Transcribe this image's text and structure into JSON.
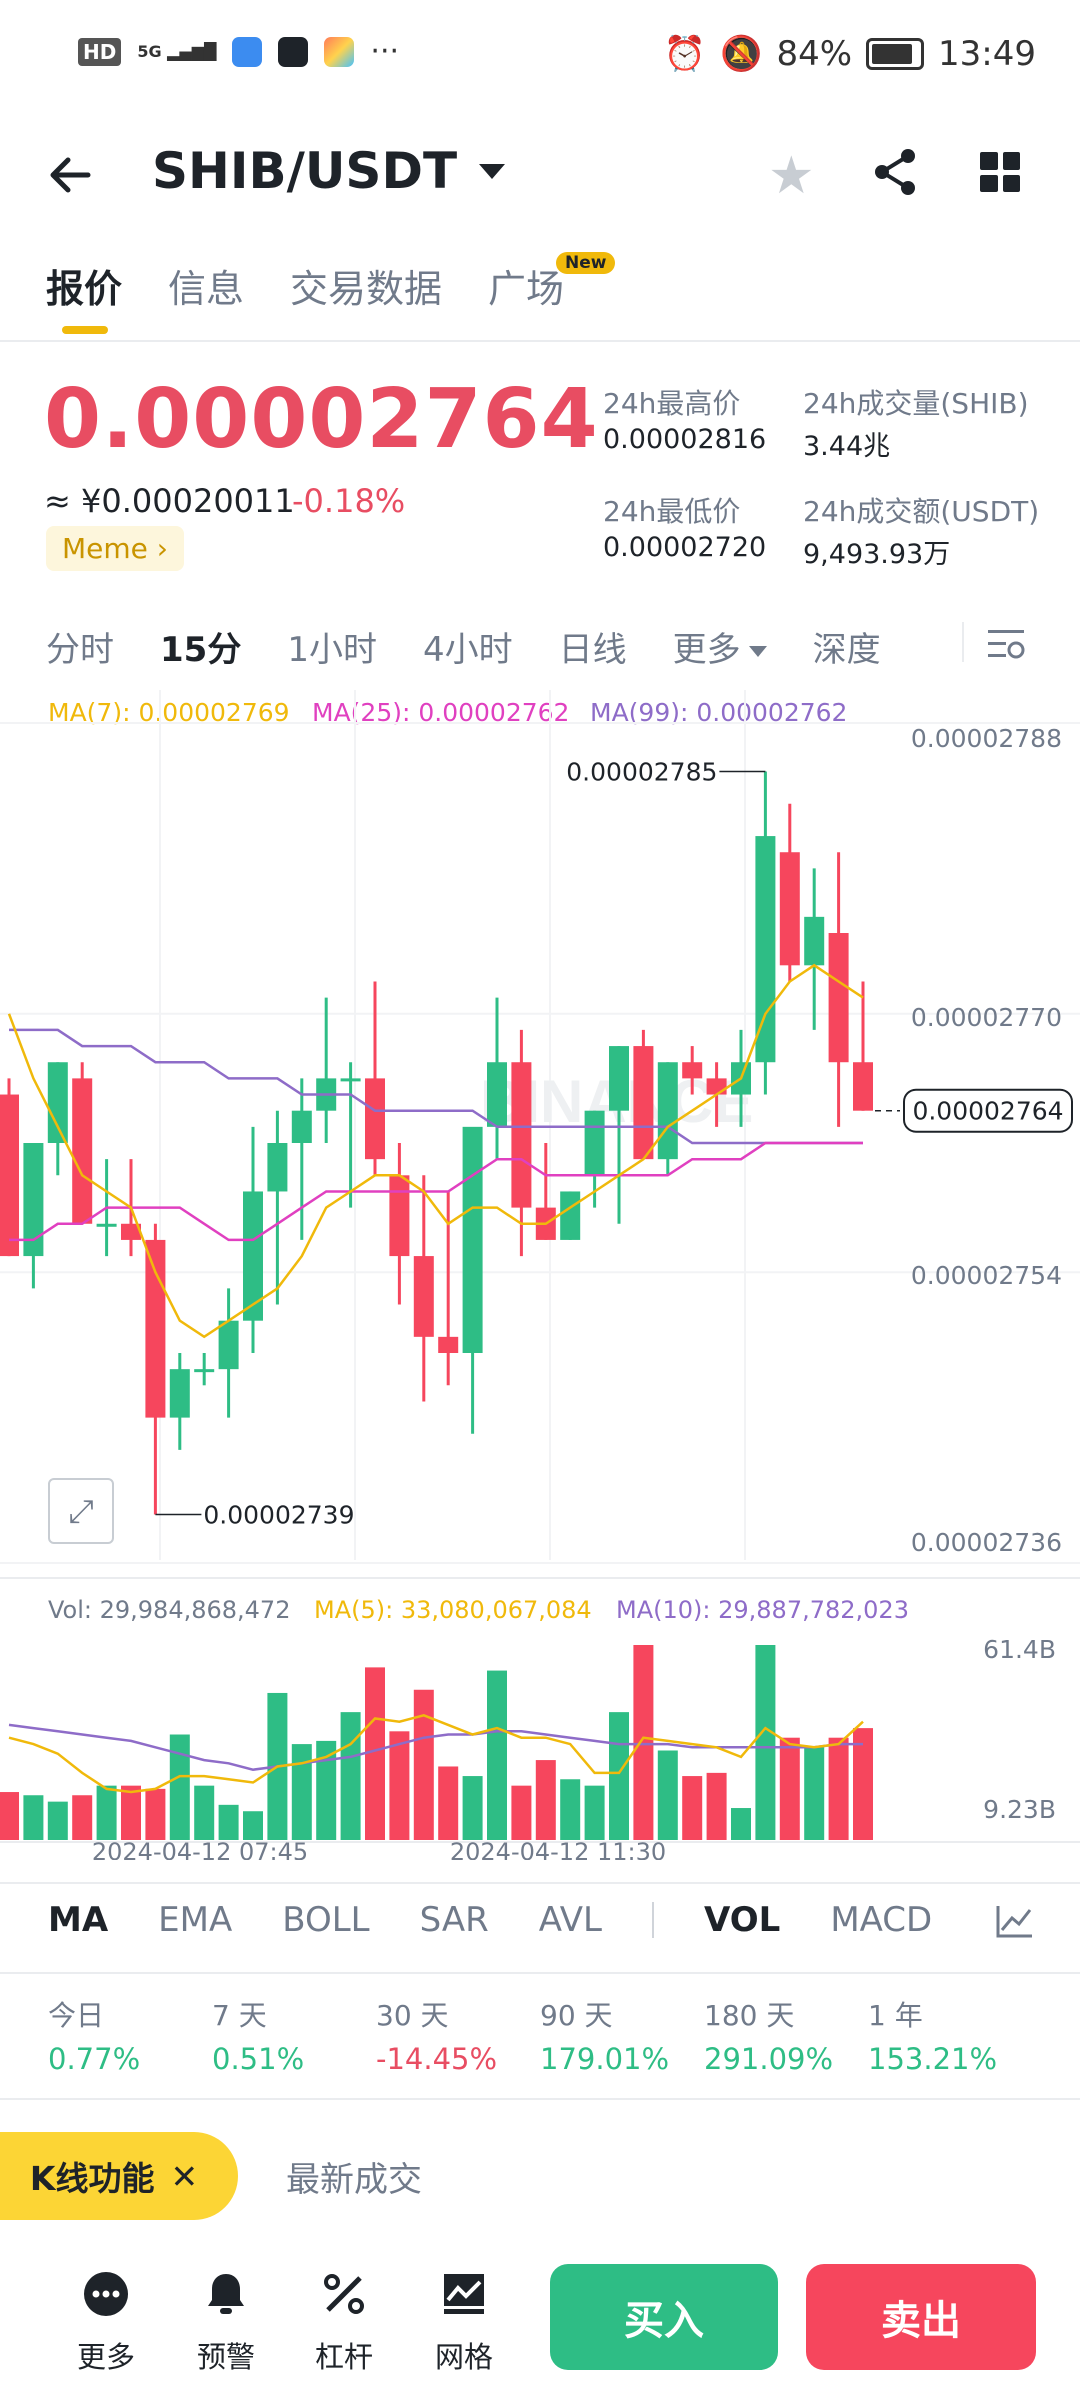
{
  "status_bar": {
    "network": "5G",
    "battery": "84%",
    "time": "13:49",
    "hd": "HD",
    "more": "···"
  },
  "header": {
    "pair": "SHIB/USDT"
  },
  "tabs": [
    {
      "label": "报价"
    },
    {
      "label": "信息"
    },
    {
      "label": "交易数据"
    },
    {
      "label": "广场"
    }
  ],
  "tab_new_badge": "New",
  "price": {
    "last": "0.00002764",
    "cny": "≈ ¥0.00020011",
    "change": "-0.18%",
    "tag": "Meme"
  },
  "stats": {
    "high_label": "24h最高价",
    "high": "0.00002816",
    "vol_label": "24h成交量(SHIB)",
    "vol": "3.44兆",
    "low_label": "24h最低价",
    "low": "0.00002720",
    "amount_label": "24h成交额(USDT)",
    "amount": "9,493.93万"
  },
  "intervals": [
    "分时",
    "15分",
    "1小时",
    "4小时",
    "日线",
    "更多",
    "深度"
  ],
  "ma_legend": {
    "ma7": "MA(7): 0.00002769",
    "ma25": "MA(25): 0.00002762",
    "ma99": "MA(99): 0.00002762"
  },
  "vol_legend": {
    "vol": "Vol: 29,984,868,472",
    "ma5": "MA(5): 33,080,067,084",
    "ma10": "MA(10): 29,887,782,023"
  },
  "indicators": [
    "MA",
    "EMA",
    "BOLL",
    "SAR",
    "AVL",
    "VOL",
    "MACD"
  ],
  "performance": [
    {
      "label": "今日",
      "value": "0.77%",
      "dir": "up"
    },
    {
      "label": "7 天",
      "value": "0.51%",
      "dir": "up"
    },
    {
      "label": "30 天",
      "value": "-14.45%",
      "dir": "down"
    },
    {
      "label": "90 天",
      "value": "179.01%",
      "dir": "up"
    },
    {
      "label": "180 天",
      "value": "291.09%",
      "dir": "up"
    },
    {
      "label": "1 年",
      "value": "153.21%",
      "dir": "up"
    }
  ],
  "bottom": {
    "kline_label": "K线功能",
    "latest_trades": "最新成交",
    "more": "更多",
    "alert": "预警",
    "leverage": "杠杆",
    "grid": "网格",
    "buy": "买入",
    "sell": "卖出"
  },
  "colors": {
    "up": "#2ebd85",
    "down": "#f6465d",
    "ma7": "#f0b90b",
    "ma25": "#e040c0",
    "ma99": "#8e6cc8"
  },
  "chart_data": {
    "type": "candlestick",
    "price_axis": {
      "ticks": [
        "0.00002788",
        "0.00002770",
        "0.00002754",
        "0.00002736"
      ],
      "ylim": [
        2.736e-05,
        2.788e-05
      ]
    },
    "last_price_label": "0.00002764",
    "high_marker": "0.00002785",
    "low_marker": "0.00002739",
    "time_labels": [
      "2024-04-12 07:45",
      "2024-04-12 11:30"
    ],
    "volume_axis": {
      "ticks": [
        "61.4B",
        "9.23B"
      ]
    },
    "candles": [
      {
        "o": 2.765e-05,
        "h": 2.766e-05,
        "l": 2.755e-05,
        "c": 2.755e-05
      },
      {
        "o": 2.755e-05,
        "h": 2.762e-05,
        "l": 2.753e-05,
        "c": 2.762e-05
      },
      {
        "o": 2.762e-05,
        "h": 2.767e-05,
        "l": 2.76e-05,
        "c": 2.767e-05
      },
      {
        "o": 2.766e-05,
        "h": 2.767e-05,
        "l": 2.757e-05,
        "c": 2.757e-05
      },
      {
        "o": 2.757e-05,
        "h": 2.761e-05,
        "l": 2.755e-05,
        "c": 2.757e-05
      },
      {
        "o": 2.757e-05,
        "h": 2.761e-05,
        "l": 2.755e-05,
        "c": 2.756e-05
      },
      {
        "o": 2.756e-05,
        "h": 2.757e-05,
        "l": 2.739e-05,
        "c": 2.745e-05
      },
      {
        "o": 2.745e-05,
        "h": 2.749e-05,
        "l": 2.743e-05,
        "c": 2.748e-05
      },
      {
        "o": 2.748e-05,
        "h": 2.749e-05,
        "l": 2.747e-05,
        "c": 2.748e-05
      },
      {
        "o": 2.748e-05,
        "h": 2.753e-05,
        "l": 2.745e-05,
        "c": 2.751e-05
      },
      {
        "o": 2.751e-05,
        "h": 2.763e-05,
        "l": 2.749e-05,
        "c": 2.759e-05
      },
      {
        "o": 2.759e-05,
        "h": 2.764e-05,
        "l": 2.752e-05,
        "c": 2.762e-05
      },
      {
        "o": 2.762e-05,
        "h": 2.766e-05,
        "l": 2.756e-05,
        "c": 2.764e-05
      },
      {
        "o": 2.764e-05,
        "h": 2.771e-05,
        "l": 2.762e-05,
        "c": 2.766e-05
      },
      {
        "o": 2.766e-05,
        "h": 2.767e-05,
        "l": 2.758e-05,
        "c": 2.766e-05
      },
      {
        "o": 2.766e-05,
        "h": 2.772e-05,
        "l": 2.76e-05,
        "c": 2.761e-05
      },
      {
        "o": 2.76e-05,
        "h": 2.762e-05,
        "l": 2.752e-05,
        "c": 2.755e-05
      },
      {
        "o": 2.755e-05,
        "h": 2.76e-05,
        "l": 2.746e-05,
        "c": 2.75e-05
      },
      {
        "o": 2.75e-05,
        "h": 2.759e-05,
        "l": 2.747e-05,
        "c": 2.749e-05
      },
      {
        "o": 2.749e-05,
        "h": 2.762e-05,
        "l": 2.744e-05,
        "c": 2.763e-05
      },
      {
        "o": 2.763e-05,
        "h": 2.771e-05,
        "l": 2.761e-05,
        "c": 2.767e-05
      },
      {
        "o": 2.767e-05,
        "h": 2.769e-05,
        "l": 2.755e-05,
        "c": 2.758e-05
      },
      {
        "o": 2.758e-05,
        "h": 2.762e-05,
        "l": 2.756e-05,
        "c": 2.756e-05
      },
      {
        "o": 2.756e-05,
        "h": 2.759e-05,
        "l": 2.756e-05,
        "c": 2.759e-05
      },
      {
        "o": 2.76e-05,
        "h": 2.764e-05,
        "l": 2.758e-05,
        "c": 2.764e-05
      },
      {
        "o": 2.764e-05,
        "h": 2.768e-05,
        "l": 2.757e-05,
        "c": 2.768e-05
      },
      {
        "o": 2.768e-05,
        "h": 2.769e-05,
        "l": 2.761e-05,
        "c": 2.761e-05
      },
      {
        "o": 2.761e-05,
        "h": 2.767e-05,
        "l": 2.76e-05,
        "c": 2.767e-05
      },
      {
        "o": 2.767e-05,
        "h": 2.768e-05,
        "l": 2.765e-05,
        "c": 2.766e-05
      },
      {
        "o": 2.766e-05,
        "h": 2.767e-05,
        "l": 2.763e-05,
        "c": 2.765e-05
      },
      {
        "o": 2.765e-05,
        "h": 2.769e-05,
        "l": 2.763e-05,
        "c": 2.767e-05
      },
      {
        "o": 2.767e-05,
        "h": 2.785e-05,
        "l": 2.765e-05,
        "c": 2.781e-05
      },
      {
        "o": 2.78e-05,
        "h": 2.783e-05,
        "l": 2.772e-05,
        "c": 2.773e-05
      },
      {
        "o": 2.773e-05,
        "h": 2.779e-05,
        "l": 2.769e-05,
        "c": 2.776e-05
      },
      {
        "o": 2.775e-05,
        "h": 2.78e-05,
        "l": 2.763e-05,
        "c": 2.767e-05
      },
      {
        "o": 2.767e-05,
        "h": 2.772e-05,
        "l": 2.764e-05,
        "c": 2.764e-05
      }
    ],
    "ma7": [
      2.77e-05,
      2.766e-05,
      2.763e-05,
      2.76e-05,
      2.759e-05,
      2.758e-05,
      2.754e-05,
      2.751e-05,
      2.75e-05,
      2.751e-05,
      2.752e-05,
      2.753e-05,
      2.755e-05,
      2.758e-05,
      2.759e-05,
      2.76e-05,
      2.76e-05,
      2.759e-05,
      2.757e-05,
      2.758e-05,
      2.758e-05,
      2.757e-05,
      2.757e-05,
      2.758e-05,
      2.759e-05,
      2.76e-05,
      2.761e-05,
      2.763e-05,
      2.764e-05,
      2.765e-05,
      2.766e-05,
      2.77e-05,
      2.772e-05,
      2.773e-05,
      2.772e-05,
      2.771e-05
    ],
    "ma25": [
      2.756e-05,
      2.756e-05,
      2.757e-05,
      2.757e-05,
      2.758e-05,
      2.758e-05,
      2.758e-05,
      2.758e-05,
      2.757e-05,
      2.756e-05,
      2.756e-05,
      2.757e-05,
      2.758e-05,
      2.759e-05,
      2.759e-05,
      2.759e-05,
      2.759e-05,
      2.759e-05,
      2.759e-05,
      2.76e-05,
      2.761e-05,
      2.761e-05,
      2.76e-05,
      2.76e-05,
      2.76e-05,
      2.76e-05,
      2.76e-05,
      2.76e-05,
      2.761e-05,
      2.761e-05,
      2.761e-05,
      2.762e-05,
      2.762e-05,
      2.762e-05,
      2.762e-05,
      2.762e-05
    ],
    "ma99": [
      2.769e-05,
      2.769e-05,
      2.769e-05,
      2.768e-05,
      2.768e-05,
      2.768e-05,
      2.767e-05,
      2.767e-05,
      2.767e-05,
      2.766e-05,
      2.766e-05,
      2.766e-05,
      2.765e-05,
      2.765e-05,
      2.765e-05,
      2.764e-05,
      2.764e-05,
      2.764e-05,
      2.764e-05,
      2.764e-05,
      2.763e-05,
      2.763e-05,
      2.763e-05,
      2.763e-05,
      2.763e-05,
      2.763e-05,
      2.763e-05,
      2.763e-05,
      2.762e-05,
      2.762e-05,
      2.762e-05,
      2.762e-05,
      2.762e-05,
      2.762e-05,
      2.762e-05,
      2.762e-05
    ],
    "volumes": [
      15,
      14,
      12,
      14,
      17,
      17,
      16,
      33,
      17,
      11,
      9,
      46,
      30,
      31,
      40,
      54,
      34,
      47,
      23,
      20,
      53,
      17,
      25,
      19,
      17,
      40,
      61,
      28,
      20,
      21,
      10,
      61,
      32,
      29,
      32,
      35
    ],
    "vol_ma5": [
      32,
      30,
      27,
      21,
      16,
      15,
      16,
      20,
      20,
      19,
      18,
      23,
      24,
      26,
      30,
      38,
      37,
      39,
      36,
      33,
      35,
      32,
      32,
      30,
      21,
      21,
      32,
      31,
      30,
      29,
      26,
      35,
      30,
      29,
      30,
      37
    ],
    "vol_ma10": [
      36,
      35,
      34,
      33,
      32,
      31,
      29,
      27,
      25,
      24,
      22,
      23,
      24,
      25,
      26,
      28,
      30,
      32,
      33,
      33,
      34,
      34,
      33,
      32,
      31,
      30,
      30,
      30,
      29,
      29,
      29,
      29,
      29,
      29,
      30,
      30
    ]
  }
}
